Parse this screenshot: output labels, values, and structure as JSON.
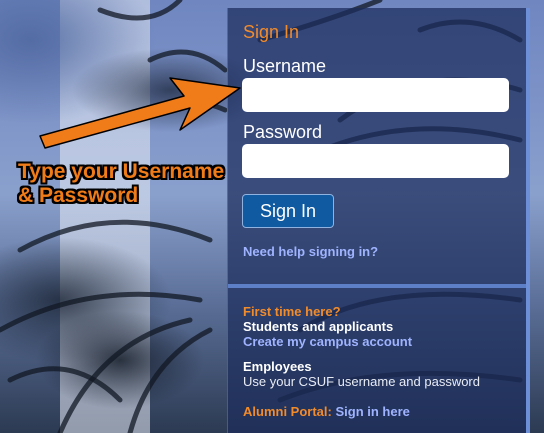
{
  "signin": {
    "title": "Sign In",
    "username_label": "Username",
    "username_value": "",
    "password_label": "Password",
    "password_value": "",
    "submit_label": "Sign In",
    "help_link": "Need help signing in?"
  },
  "info": {
    "first_time": "First time here?",
    "students_heading": "Students and applicants",
    "create_account_link": "Create my campus account",
    "employees_heading": "Employees",
    "employees_text": "Use your CSUF username and password",
    "alumni_label": "Alumni Portal:",
    "alumni_link": "Sign in here"
  },
  "annotation": {
    "line1": "Type your Username",
    "line2": "& Password"
  },
  "colors": {
    "accent_orange": "#f28b2a",
    "link_blue": "#9fb3ff",
    "button_blue": "#0f5aa0",
    "panel_navy": "#1c2c5c"
  }
}
